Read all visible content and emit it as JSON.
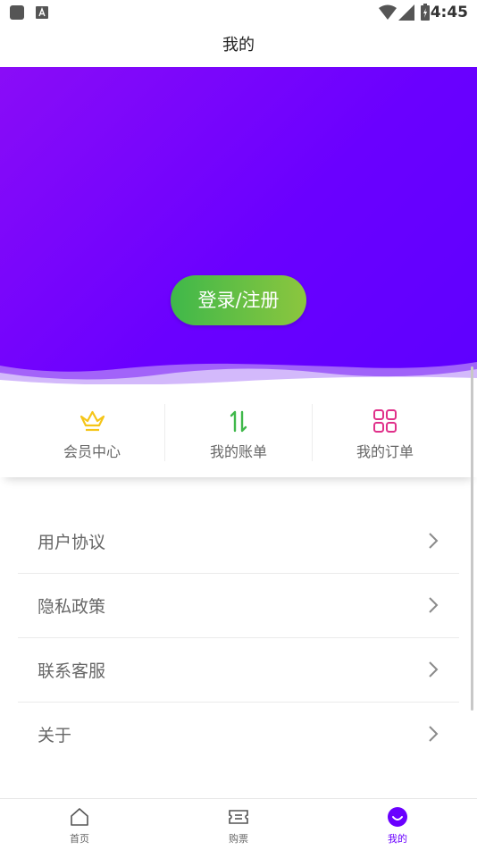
{
  "status_bar": {
    "time": "4:45"
  },
  "title_bar": {
    "title": "我的"
  },
  "hero": {
    "login_label": "登录/注册"
  },
  "shortcuts": [
    {
      "label": "会员中心",
      "icon": "crown-icon",
      "color": "#f5c518"
    },
    {
      "label": "我的账单",
      "icon": "transfer-arrows-icon",
      "color": "#3fb84a"
    },
    {
      "label": "我的订单",
      "icon": "grid-icon",
      "color": "#e0308a"
    }
  ],
  "menu": [
    {
      "label": "用户协议"
    },
    {
      "label": "隐私政策"
    },
    {
      "label": "联系客服"
    },
    {
      "label": "关于"
    }
  ],
  "tabbar": [
    {
      "label": "首页",
      "icon": "home-icon"
    },
    {
      "label": "购票",
      "icon": "ticket-icon"
    },
    {
      "label": "我的",
      "icon": "smile-icon",
      "active": true
    }
  ],
  "colors": {
    "accent": "#6a00ff",
    "login_green": "#3fb84a"
  }
}
